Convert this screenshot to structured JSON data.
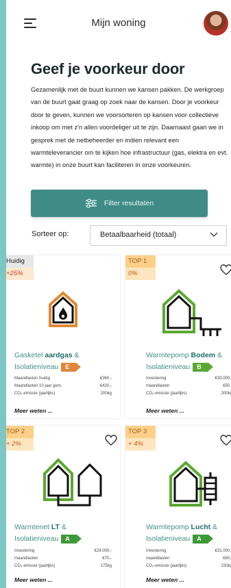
{
  "header": {
    "title": "Mijn woning"
  },
  "heading": "Geef je voorkeur door",
  "intro": "Gezamenlijk met de buurt kunnen we kansen pakken. De werkgroep van de buurt gaat graag op zoek naar de kansen. Door je voorkeur door te geven, kunnen we voorsorteren op kansen voor collectieve inkoop om met z'n allen voordeliger uit te zijn. Daarnaast gaan we in gesprek met de netbeheerder en indien relevant een warmteleverancier om te kijken hoe infrastructuur (gas, elektra en evt. warmte) in onze buurt kan faciliteren in onze voorkeuren.",
  "filter_button": "Filter resultaten",
  "sort": {
    "label": "Sorteer op:",
    "value": "Betaalbaarheid (totaal)"
  },
  "cards": [
    {
      "badge": "Huidig",
      "percent": "+25%",
      "title_pre": "Gasketel ",
      "title_bold": "aardgas",
      "title_post": " &",
      "title_line2": "Isolatieniveau",
      "label": "E",
      "label_color": "#e0863a",
      "rows": [
        [
          "Maandlasten huidig",
          "€360,-"
        ],
        [
          "Maandlasten 10 jaar gem.",
          "€420,-"
        ],
        [
          "CO₂-emissie (jaarlijks)",
          "200kg"
        ]
      ],
      "more": "Meer weten ..."
    },
    {
      "badge": "TOP 1",
      "percent": "0%",
      "title_pre": "Warmtepomp ",
      "title_bold": "Bodem",
      "title_post": " &",
      "title_line2": "Isolatieniveau",
      "label": "B",
      "label_color": "#5aa832",
      "rows": [
        [
          "Investering",
          "€30.000,-"
        ],
        [
          "maandlasten",
          "€50,-"
        ],
        [
          "CO₂-emissie (jaarlijks)",
          "200kg"
        ]
      ],
      "more": "Meer weten ..."
    },
    {
      "badge": "TOP 2",
      "percent": "+ 2%",
      "title_pre": "Warmtenet ",
      "title_bold": "LT",
      "title_post": " &",
      "title_line2": "Isolatieniveau",
      "label": "A",
      "label_color": "#3e9a38",
      "rows": [
        [
          "Investering",
          "€29.000,-"
        ],
        [
          "maandlasten",
          "€70,-"
        ],
        [
          "CO₂-emissie (jaarlijks)",
          "175kg"
        ]
      ],
      "more": "Meer weten ..."
    },
    {
      "badge": "TOP 3",
      "percent": "+ 4%",
      "title_pre": "Warmtepomp ",
      "title_bold": "Lucht",
      "title_post": " &",
      "title_line2": "Isolatieniveau",
      "label": "A",
      "label_color": "#3e9a38",
      "rows": [
        [
          "Investering",
          "€31.000,-"
        ],
        [
          "maandlasten",
          "€60,-"
        ],
        [
          "CO₂-emissie (jaarlijks)",
          "230kg"
        ]
      ],
      "more": "Meer weten ..."
    }
  ]
}
